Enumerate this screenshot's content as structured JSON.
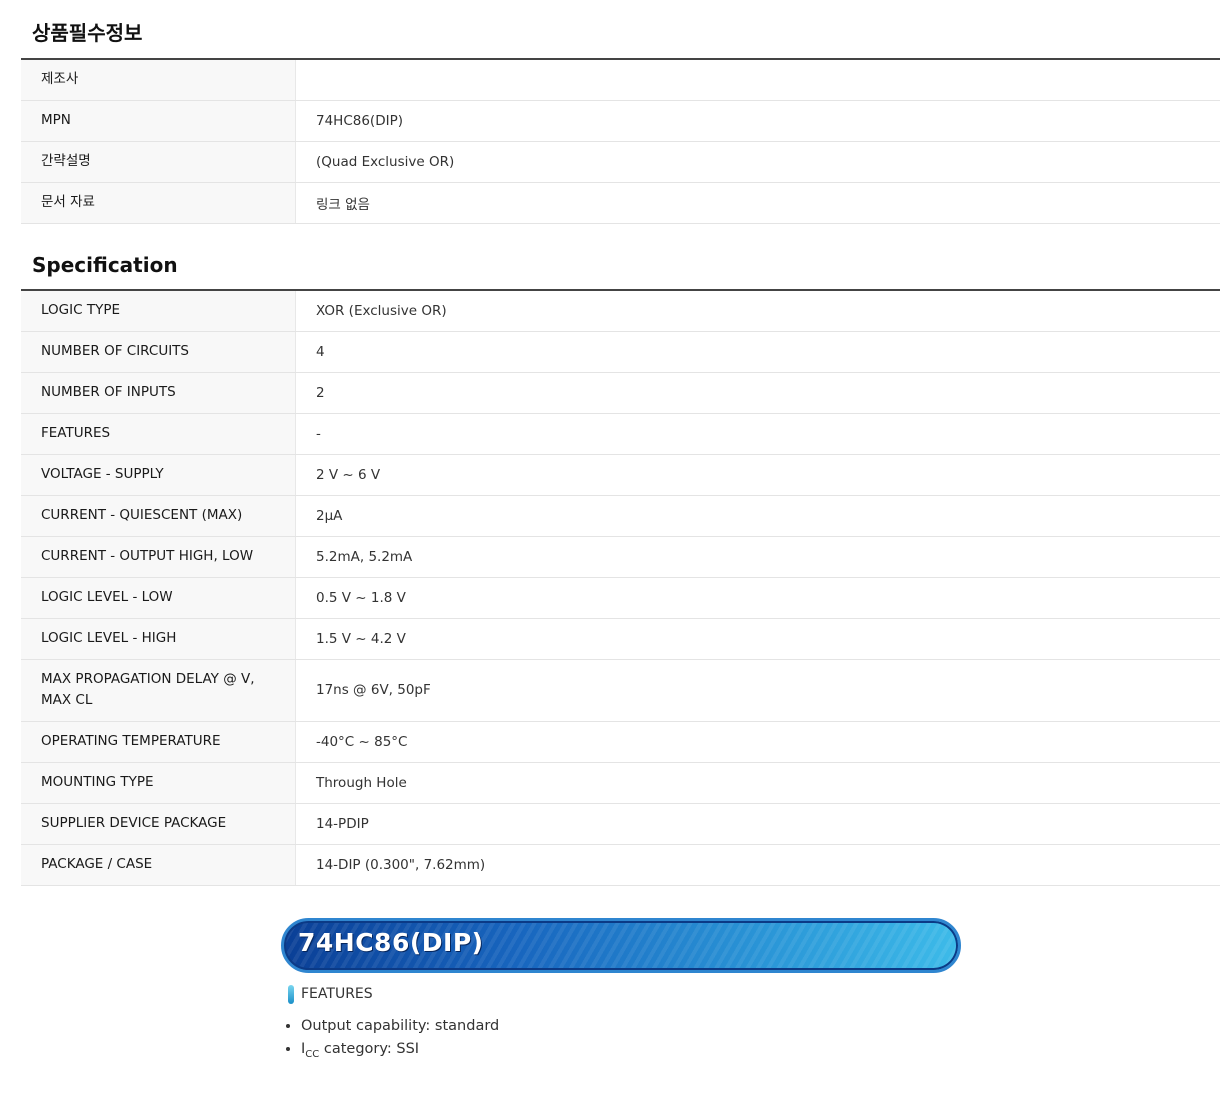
{
  "section1": {
    "title": "상품필수정보",
    "rows": [
      {
        "key": "제조사",
        "value": ""
      },
      {
        "key": "MPN",
        "value": "74HC86(DIP)"
      },
      {
        "key": "간략설명",
        "value": "(Quad Exclusive OR)"
      },
      {
        "key": "문서 자료",
        "value": "링크 없음"
      }
    ]
  },
  "section2": {
    "title": "Specification",
    "rows": [
      {
        "key": "LOGIC TYPE",
        "value": "XOR (Exclusive OR)"
      },
      {
        "key": "NUMBER OF CIRCUITS",
        "value": "4"
      },
      {
        "key": "NUMBER OF INPUTS",
        "value": "2"
      },
      {
        "key": "FEATURES",
        "value": "-"
      },
      {
        "key": "VOLTAGE - SUPPLY",
        "value": "2 V ~ 6 V"
      },
      {
        "key": "CURRENT - QUIESCENT (MAX)",
        "value": "2µA"
      },
      {
        "key": "CURRENT - OUTPUT HIGH, LOW",
        "value": "5.2mA, 5.2mA"
      },
      {
        "key": "LOGIC LEVEL - LOW",
        "value": "0.5 V ~ 1.8 V"
      },
      {
        "key": "LOGIC LEVEL - HIGH",
        "value": "1.5 V ~ 4.2 V"
      },
      {
        "key": "MAX PROPAGATION DELAY @ V, MAX CL",
        "value": "17ns @ 6V, 50pF"
      },
      {
        "key": "OPERATING TEMPERATURE",
        "value": "-40°C ~ 85°C"
      },
      {
        "key": "MOUNTING TYPE",
        "value": "Through Hole"
      },
      {
        "key": "SUPPLIER DEVICE PACKAGE",
        "value": "14-PDIP"
      },
      {
        "key": "PACKAGE / CASE",
        "value": "14-DIP (0.300\", 7.62mm)"
      }
    ]
  },
  "banner": {
    "text": "74HC86(DIP)"
  },
  "features": {
    "heading": "FEATURES",
    "item1": "Output capability: standard",
    "item2_prefix": "I",
    "item2_sub": "CC",
    "item2_rest": " category: SSI"
  }
}
